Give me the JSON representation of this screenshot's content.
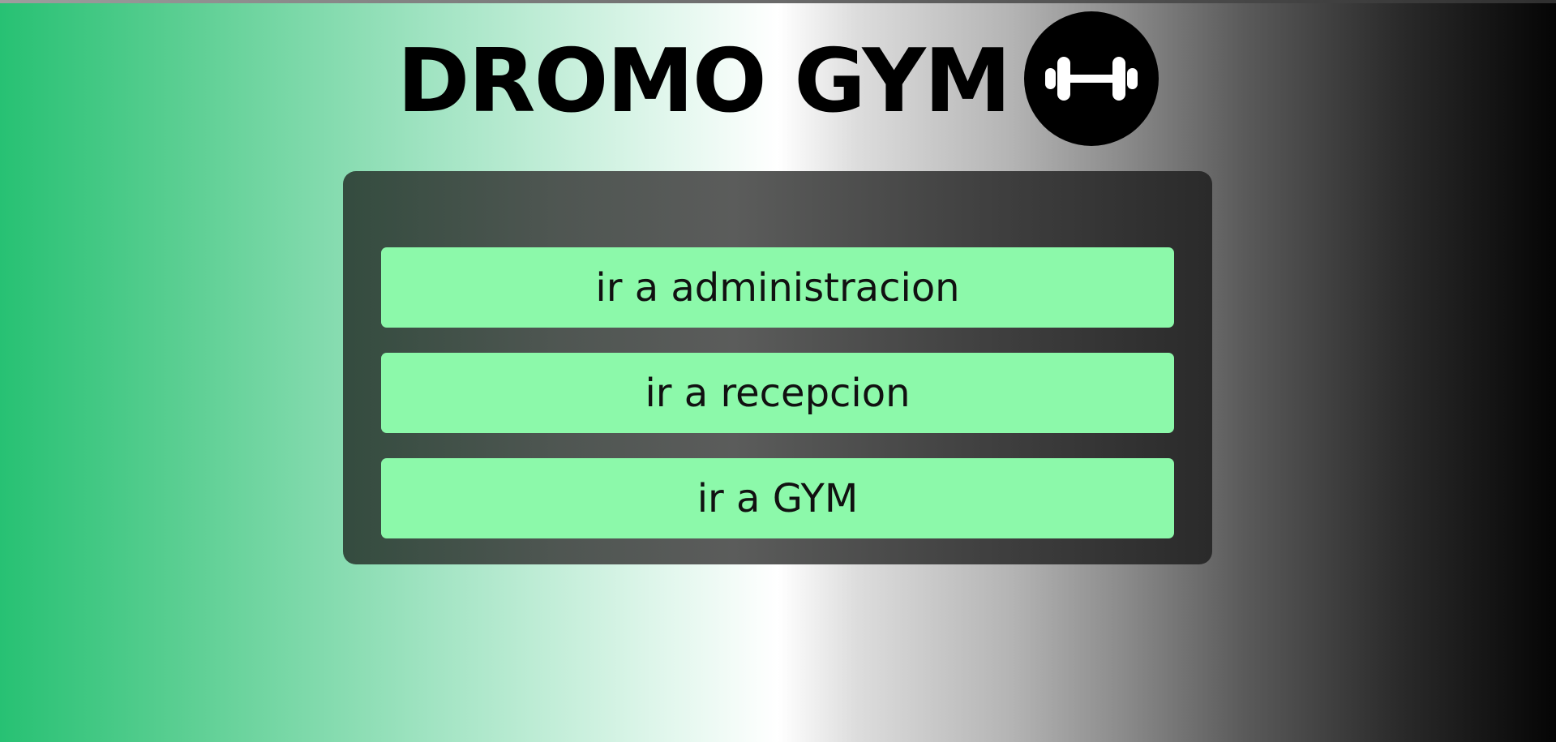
{
  "header": {
    "title": "DROMO GYM",
    "logo_icon": "dumbbell-icon"
  },
  "menu": {
    "buttons": [
      {
        "label": "ir a administracion"
      },
      {
        "label": "ir a recepcion"
      },
      {
        "label": "ir a GYM"
      }
    ]
  },
  "colors": {
    "background_left": "#27c173",
    "background_center": "#ffffff",
    "background_right": "#050505",
    "panel": "#4f5652",
    "button": "#8cf9aa",
    "text": "#000000"
  }
}
